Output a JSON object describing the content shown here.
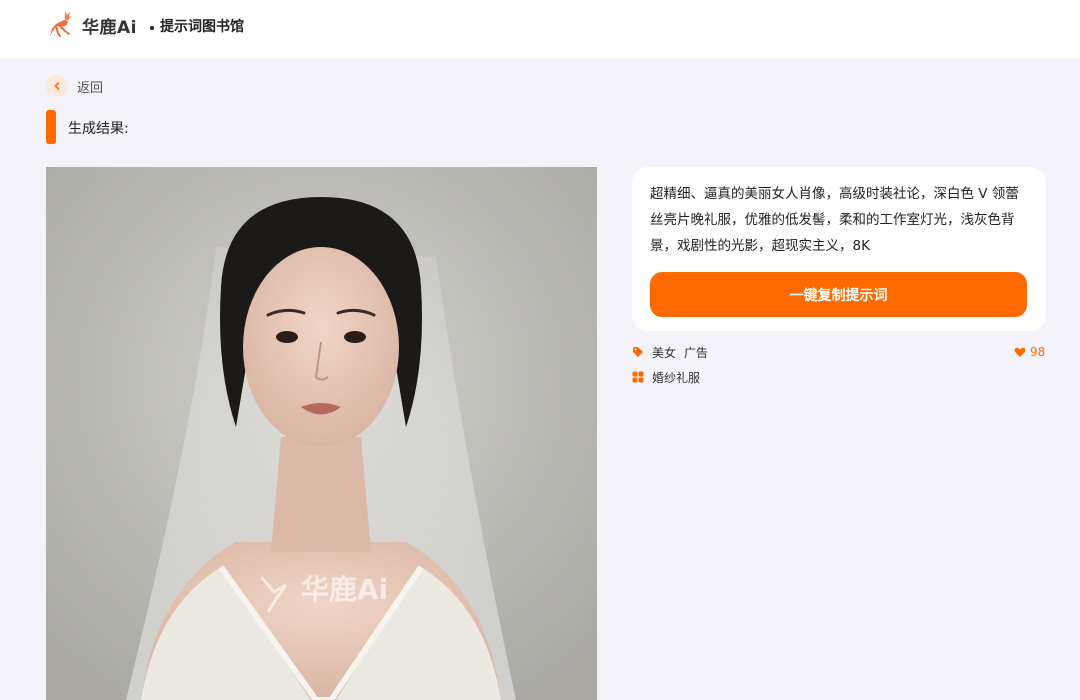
{
  "header": {
    "brand": "华鹿Ai",
    "section": "提示词图书馆"
  },
  "nav": {
    "back_label": "返回"
  },
  "result": {
    "title": "生成结果:"
  },
  "image": {
    "watermark": "华鹿Ai"
  },
  "prompt": {
    "text": "超精细、逼真的美丽女人肖像，高级时装社论，深白色 V 领蕾丝亮片晚礼服，优雅的低发髻，柔和的工作室灯光，浅灰色背景，戏剧性的光影，超现实主义，8K",
    "copy_label": "一键复制提示词"
  },
  "tags": {
    "row1": [
      "美女",
      "广告"
    ],
    "row2": [
      "婚纱礼服"
    ]
  },
  "likes": {
    "count": "98"
  },
  "colors": {
    "accent": "#ff6a00",
    "background": "#f4f3f9"
  },
  "icons": {
    "logo": "deer-logo-icon",
    "back": "chevron-left-icon",
    "tag": "tag-icon",
    "category": "grid-icon",
    "like": "heart-icon"
  }
}
